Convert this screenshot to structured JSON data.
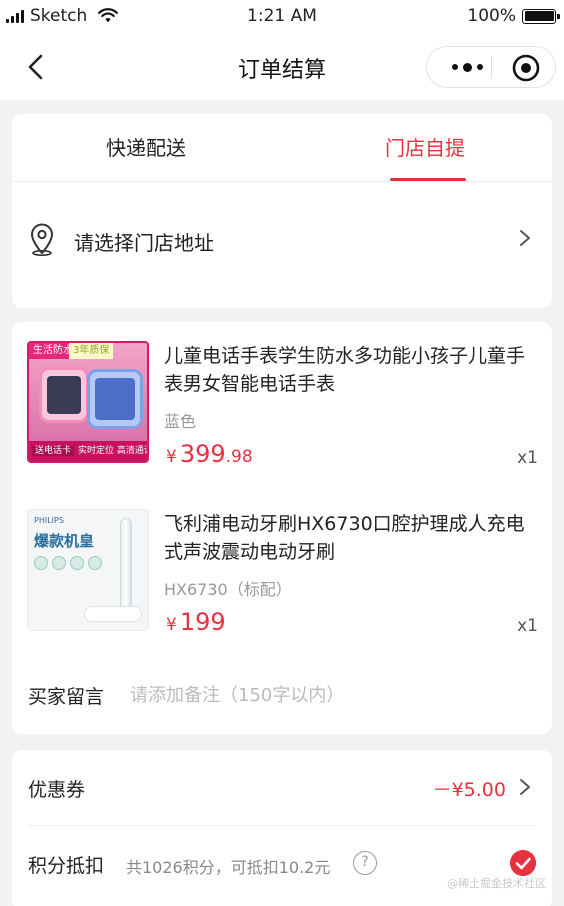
{
  "status_bar": {
    "carrier": "Sketch",
    "time": "1:21 AM",
    "battery": "100%"
  },
  "nav": {
    "title": "订单结算",
    "icons": [
      "back-icon",
      "more-icon",
      "target-icon"
    ]
  },
  "delivery": {
    "tabs": [
      "快递配送",
      "门店自提"
    ],
    "active_tab": "门店自提",
    "store_placeholder": "请选择门店地址",
    "icons": [
      "location-icon",
      "chevron-right-icon"
    ]
  },
  "products": [
    {
      "name": "儿童电话手表学生防水多功能小孩子儿童手表男女智能电话手表",
      "spec": "蓝色",
      "currency": "¥",
      "price_int": "399",
      "price_dec": ".98",
      "qty": "x1",
      "thumb": {
        "badge_top": "生活防水",
        "badge_top2": "3年质保",
        "badge_bottom_main": "送电话卡",
        "badge_bottom_rest": "实时定位  高清通话"
      }
    },
    {
      "name": "飞利浦电动牙刷HX6730口腔护理成人充电式声波震动电动牙刷",
      "spec": "HX6730（标配）",
      "currency": "¥",
      "price_int": "199",
      "price_dec": "",
      "qty": "x1",
      "thumb": {
        "brand": "PHILIPS",
        "title": "爆款机皇"
      }
    }
  ],
  "remark": {
    "label": "买家留言",
    "placeholder": "请添加备注（150字以内）"
  },
  "coupon": {
    "label": "优惠券",
    "value": "－¥5.00"
  },
  "points": {
    "label": "积分抵扣",
    "desc": "共1026积分，可抵扣10.2元",
    "help": "?",
    "checked": true
  },
  "watermark": "@稀土掘金技术社区",
  "colors": {
    "accent": "#e8313f",
    "background": "#f2f2f2",
    "card": "#ffffff"
  }
}
